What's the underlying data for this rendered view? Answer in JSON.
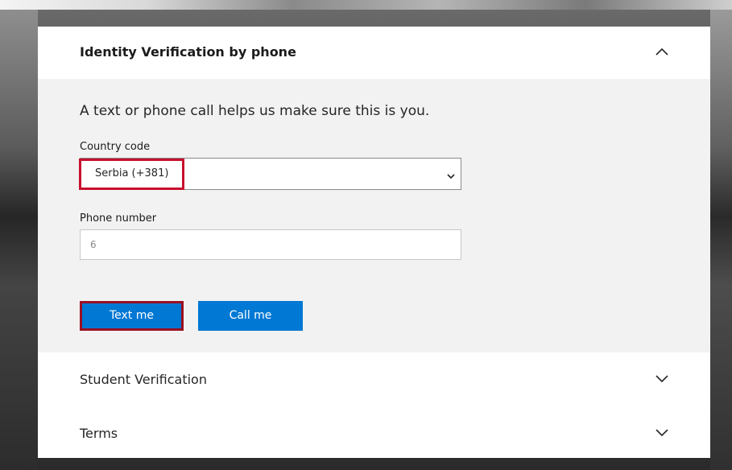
{
  "panel": {
    "header": {
      "title": "Identity Verification by phone",
      "chevron_icon": "chevron-up-icon"
    },
    "intro_text": "A text or phone call helps us make sure this is you.",
    "country_code": {
      "label": "Country code",
      "selected_value": "Serbia (+381)",
      "chevron_icon": "chevron-down-icon"
    },
    "phone_number": {
      "label": "Phone number",
      "value": "6"
    },
    "buttons": {
      "text_me": "Text me",
      "call_me": "Call me"
    },
    "sections": [
      {
        "label": "Student Verification",
        "chevron_icon": "chevron-down-icon"
      },
      {
        "label": "Terms",
        "chevron_icon": "chevron-down-icon"
      }
    ]
  },
  "colors": {
    "accent": "#0078d4",
    "highlight": "#c8102e",
    "body_background": "#f2f2f2"
  }
}
